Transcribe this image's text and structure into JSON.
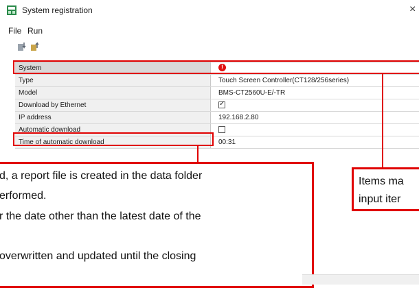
{
  "window": {
    "title": "System registration",
    "close_glyph": "×"
  },
  "menu": [
    "File",
    "Run"
  ],
  "toolbar": {
    "icons": [
      "download-icon",
      "upload-icon"
    ]
  },
  "rows": [
    {
      "label": "System",
      "value": "",
      "kind": "error"
    },
    {
      "label": "Type",
      "value": "Touch Screen Controller(CT128/256series)",
      "kind": "text"
    },
    {
      "label": "Model",
      "value": "BMS-CT2560U-E/-TR",
      "kind": "text"
    },
    {
      "label": "Download by Ethernet",
      "value": "",
      "kind": "checkbox-checked"
    },
    {
      "label": "IP address",
      "value": "192.168.2.80",
      "kind": "text"
    },
    {
      "label": "Automatic download",
      "value": "",
      "kind": "checkbox"
    },
    {
      "label": "Time of automatic download",
      "value": "00:31",
      "kind": "text"
    }
  ],
  "error_glyph": "!",
  "check_glyph": "✓",
  "callout_left": [
    "d, a report file is created in the data folder",
    "erformed.",
    "r the date other than the latest date of the",
    "",
    "overwritten and updated until the closing"
  ],
  "callout_right": [
    "Items ma",
    "input iter"
  ],
  "colors": {
    "highlight": "#e00000",
    "label_bg": "#f0f0f0",
    "error": "#e01010"
  }
}
